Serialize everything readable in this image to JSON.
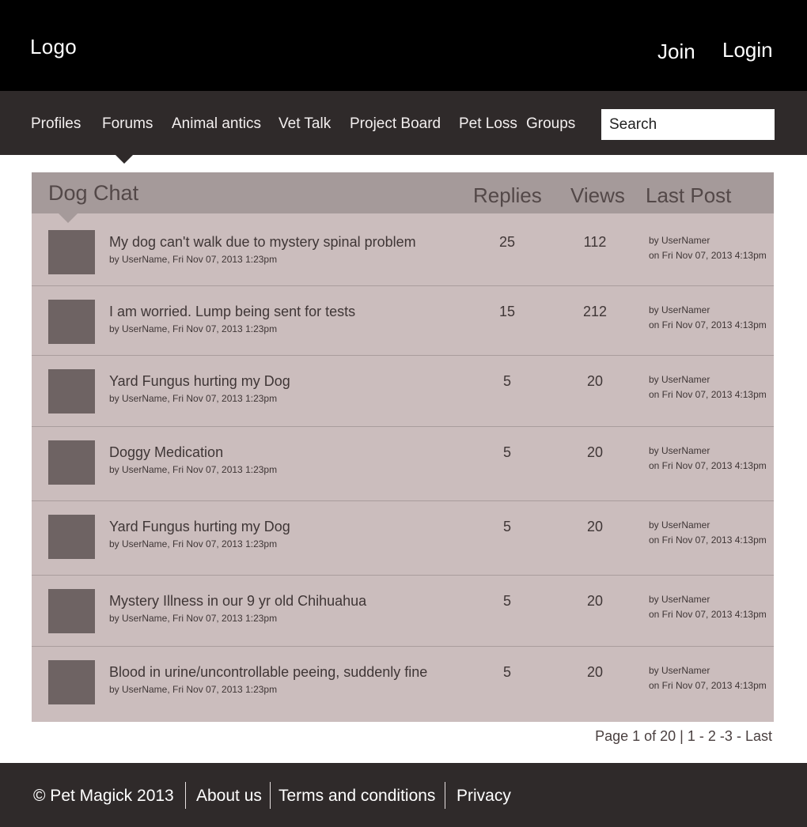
{
  "header": {
    "logo": "Logo",
    "join": "Join",
    "login": "Login"
  },
  "nav": {
    "items": [
      "Profiles",
      "Forums",
      "Animal antics",
      "Vet Talk",
      "Project Board",
      "Pet Loss",
      "Groups"
    ],
    "active": "Forums",
    "search_placeholder": "Search"
  },
  "forum": {
    "title": "Dog Chat",
    "columns": {
      "replies": "Replies",
      "views": "Views",
      "last_post": "Last Post"
    },
    "topics": [
      {
        "title": "My dog can't walk due to mystery spinal problem",
        "meta": "by UserName, Fri Nov 07, 2013 1:23pm",
        "replies": "25",
        "views": "112",
        "last_by": "by UserNamer",
        "last_on": "on Fri Nov 07, 2013 4:13pm"
      },
      {
        "title": "I am worried. Lump being sent for tests",
        "meta": "by UserName, Fri Nov 07, 2013 1:23pm",
        "replies": "15",
        "views": "212",
        "last_by": "by UserNamer",
        "last_on": "on Fri Nov 07, 2013 4:13pm"
      },
      {
        "title": "Yard Fungus hurting my Dog",
        "meta": "by UserName, Fri Nov 07, 2013 1:23pm",
        "replies": "5",
        "views": "20",
        "last_by": "by UserNamer",
        "last_on": "on Fri Nov 07, 2013 4:13pm"
      },
      {
        "title": "Doggy Medication",
        "meta": "by UserName, Fri Nov 07, 2013 1:23pm",
        "replies": "5",
        "views": "20",
        "last_by": "by UserNamer",
        "last_on": "on Fri Nov 07, 2013 4:13pm"
      },
      {
        "title": "Yard Fungus hurting my Dog",
        "meta": "by UserName, Fri Nov 07, 2013 1:23pm",
        "replies": "5",
        "views": "20",
        "last_by": "by UserNamer",
        "last_on": "on Fri Nov 07, 2013 4:13pm"
      },
      {
        "title": "Mystery Illness in our 9 yr old Chihuahua",
        "meta": "by UserName, Fri Nov 07, 2013 1:23pm",
        "replies": "5",
        "views": "20",
        "last_by": "by UserNamer",
        "last_on": "on Fri Nov 07, 2013 4:13pm"
      },
      {
        "title": "Blood in urine/uncontrollable peeing, suddenly fine",
        "meta": "by UserName, Fri Nov 07, 2013 1:23pm",
        "replies": "5",
        "views": "20",
        "last_by": "by UserNamer",
        "last_on": "on Fri Nov 07, 2013 4:13pm"
      }
    ]
  },
  "pagination": {
    "summary": "Page 1 of 20 |",
    "p1": "1",
    "p2": "2",
    "p3": "3",
    "last": "Last"
  },
  "footer": {
    "copyright": "© Pet  Magick 2013",
    "about": "About us",
    "terms": "Terms and conditions",
    "privacy": "Privacy"
  },
  "colors": {
    "topbar": "#000000",
    "navbar": "#2f2a2a",
    "table_bg": "#cbbdbd",
    "table_header": "#a59a9a",
    "thumb": "#6e6363"
  }
}
